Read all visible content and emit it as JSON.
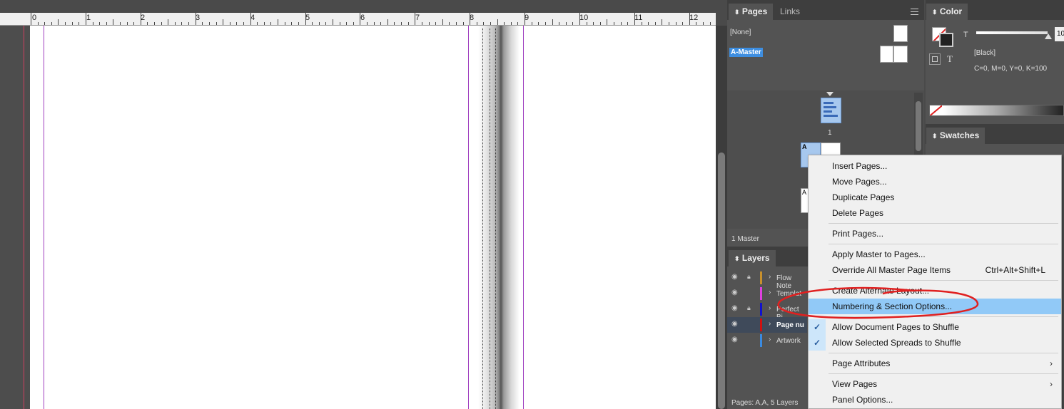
{
  "ruler": {
    "labels": [
      "0",
      "1",
      "2",
      "3",
      "4",
      "5",
      "6",
      "7",
      "8",
      "9",
      "10",
      "11",
      "12"
    ]
  },
  "pages_panel": {
    "tabs": [
      "Pages",
      "Links"
    ],
    "masters": {
      "none": "[None]",
      "a_master": "A-Master"
    },
    "page_number": "1",
    "footer_master": "1 Master",
    "status": "Pages: A,A, 5 Layers",
    "master_letter": "A"
  },
  "color_panel": {
    "title": "Color",
    "tint_letter": "T",
    "swatch_name": "[Black]",
    "values": "C=0, M=0, Y=0, K=100",
    "value_field": "10"
  },
  "swatches_panel": {
    "title": "Swatches"
  },
  "layers_panel": {
    "title": "Layers",
    "layers": [
      {
        "name": "Flow Note",
        "color": "#c8902c",
        "locked": true
      },
      {
        "name": "Templat",
        "color": "#e040e0",
        "locked": false
      },
      {
        "name": "Perfect Bi",
        "color": "#1010d0",
        "locked": true
      },
      {
        "name": "Page nu",
        "color": "#d01010",
        "locked": false,
        "active": true
      },
      {
        "name": "Artwork",
        "color": "#3a8ae0",
        "locked": false
      }
    ]
  },
  "context_menu": {
    "items": [
      {
        "label": "Insert Pages..."
      },
      {
        "label": "Move Pages..."
      },
      {
        "label": "Duplicate Pages"
      },
      {
        "label": "Delete Pages"
      },
      {
        "label": "Print Pages..."
      },
      {
        "label": "Apply Master to Pages..."
      },
      {
        "label": "Override All Master Page Items",
        "shortcut": "Ctrl+Alt+Shift+L"
      },
      {
        "label": "Create Alternate Layout..."
      },
      {
        "label": "Numbering & Section Options..."
      },
      {
        "label": "Allow Document Pages to Shuffle",
        "checked": true
      },
      {
        "label": "Allow Selected Spreads to Shuffle",
        "checked": true
      },
      {
        "label": "Page Attributes",
        "submenu": true
      },
      {
        "label": "View Pages",
        "submenu": true
      },
      {
        "label": "Panel Options..."
      }
    ]
  },
  "colors": {
    "accent": "#91c9f7",
    "annotation": "#e02020"
  }
}
